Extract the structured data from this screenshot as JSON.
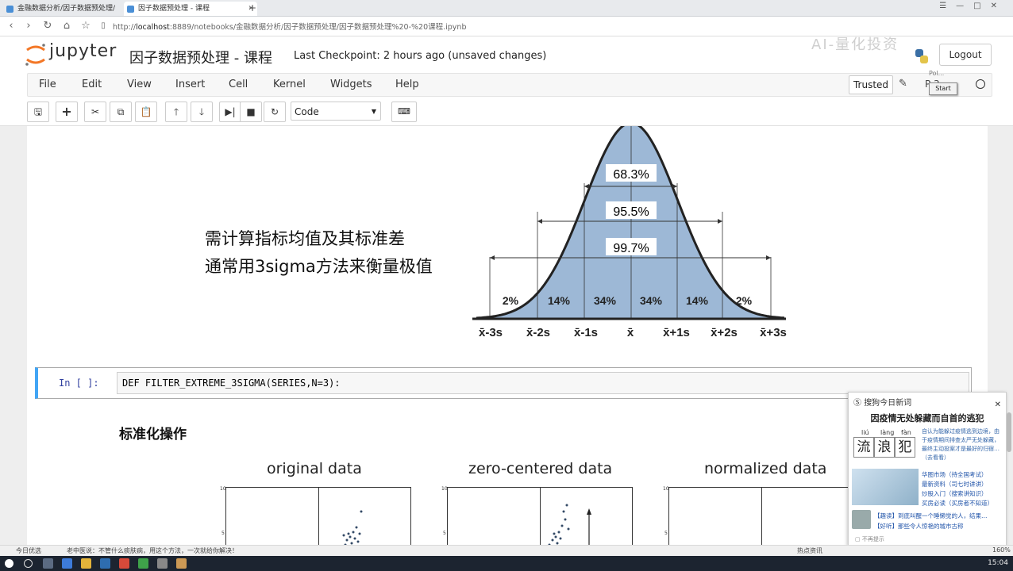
{
  "browser": {
    "tabs": [
      {
        "label": "金融数据分析/因子数据预处理/",
        "active": false
      },
      {
        "label": "因子数据预处理 - 课程",
        "active": true
      }
    ],
    "url_prefix": "http://",
    "url_host": "localhost",
    "url_rest": ":8889/notebooks/金融数据分析/因子数据预处理/因子数据预处理%20-%20课程.ipynb"
  },
  "header": {
    "logo_text": "jupyter",
    "notebook_title": "因子数据预处理 - 课程",
    "checkpoint": "Last Checkpoint: 2 hours ago (unsaved changes)",
    "logout": "Logout",
    "watermark": "AI-量化投资",
    "tooltip_text": "Pol...",
    "start_popup": "Start"
  },
  "menubar": {
    "items": [
      "File",
      "Edit",
      "View",
      "Insert",
      "Cell",
      "Kernel",
      "Widgets",
      "Help"
    ],
    "trusted": "Trusted",
    "kernel_indicator": "P  3"
  },
  "toolbar": {
    "cell_type": "Code",
    "icons": [
      "save-icon",
      "plus-icon",
      "cut-icon",
      "copy-icon",
      "paste-icon",
      "arrow-up-icon",
      "arrow-down-icon",
      "run-icon",
      "stop-icon",
      "restart-icon",
      "keyboard-icon"
    ]
  },
  "slide": {
    "line1": "需计算指标均值及其标准差",
    "line2": "通常用3sigma方法来衡量极值",
    "bell": {
      "brackets": [
        "68.3%",
        "95.5%",
        "99.7%"
      ],
      "segments": [
        "2%",
        "14%",
        "34%",
        "34%",
        "14%",
        "2%"
      ],
      "x_labels": [
        "x̄-3s",
        "x̄-2s",
        "x̄-1s",
        "x̄",
        "x̄+1s",
        "x̄+2s",
        "x̄+3s"
      ],
      "fill_color": "#9db8d6"
    }
  },
  "code_cell": {
    "prompt": "In [ ]:",
    "code": "DEF FILTER_EXTREME_3SIGMA(SERIES,N=3):"
  },
  "section": {
    "heading": "标准化操作",
    "plots": [
      {
        "title": "original data",
        "tick_top": "10",
        "tick_mid": "5"
      },
      {
        "title": "zero-centered data",
        "tick_top": "10",
        "tick_mid": "5"
      },
      {
        "title": "normalized data",
        "tick_top": "10",
        "tick_mid": "5"
      }
    ]
  },
  "popup": {
    "header": "搜狗今日新词",
    "title": "因疫情无处躲藏而自首的逃犯",
    "pinyin": [
      "liú",
      "làng",
      "fàn"
    ],
    "chars": [
      "流",
      "浪",
      "犯"
    ],
    "desc": "自认为能躲过疫情逃到边境，由于疫情期间排查太严无处躲藏，最终主动投案才是最好的归宿…（去看看）",
    "links": [
      "华图市场（持全国考试）",
      "最新资料（司七时讲讲）",
      "炒股入门（搜索讲知识）",
      "买房必读（买房者不知道）"
    ],
    "news": [
      "【趣读】到底叫醒一个睡懒觉的人，结果…",
      "【好听】那些令人惊艳的城市古称"
    ],
    "footer": "不再提示"
  },
  "statusbar": {
    "left": "今日优选",
    "ad": "老中医说：不管什么痰肤病，用这个方法，一次就给你解决！",
    "right": "热点资讯",
    "zoom": "160%"
  },
  "taskbar": {
    "clock": "15:04"
  }
}
